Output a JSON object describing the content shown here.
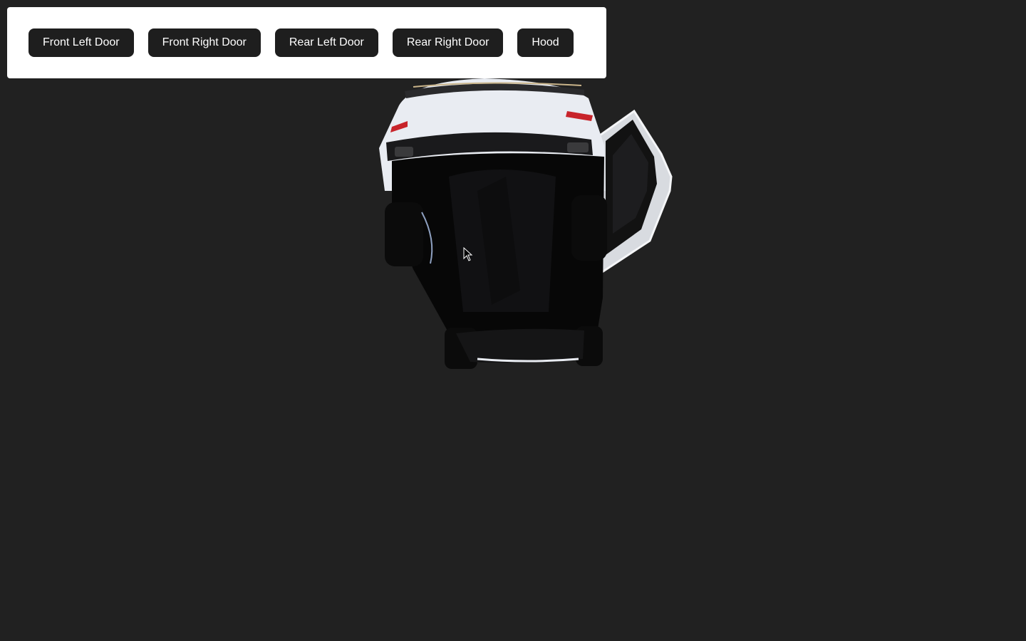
{
  "controls": {
    "buttons": [
      {
        "label": "Front Left Door"
      },
      {
        "label": "Front Right Door"
      },
      {
        "label": "Rear Left Door"
      },
      {
        "label": "Rear Right Door"
      },
      {
        "label": "Hood"
      }
    ]
  },
  "scene": {
    "background_color": "#212121",
    "car_color": "#e9ecf2",
    "taillight_color": "#c8242b"
  }
}
